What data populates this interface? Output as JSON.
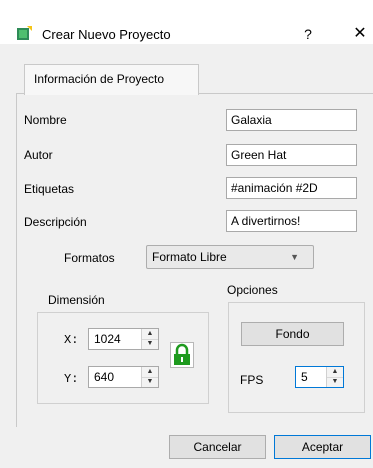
{
  "window": {
    "title": "Crear Nuevo Proyecto",
    "help_label": "?",
    "close_label": "✕"
  },
  "tabs": [
    {
      "label": "Información de Proyecto",
      "active": true
    }
  ],
  "form": {
    "name": {
      "label": "Nombre",
      "value": "Galaxia"
    },
    "author": {
      "label": "Autor",
      "value": "Green Hat"
    },
    "tags": {
      "label": "Etiquetas",
      "value": "#animación #2D"
    },
    "description": {
      "label": "Descripción",
      "value": "A divertirnos!"
    },
    "formats": {
      "label": "Formatos",
      "selected": "Formato Libre"
    }
  },
  "dimension": {
    "title": "Dimensión",
    "x_label": "X:",
    "x_value": "1024",
    "y_label": "Y:",
    "y_value": "640",
    "lock_color": "#1e9a1e"
  },
  "options": {
    "title": "Opciones",
    "background_button": "Fondo",
    "fps_label": "FPS",
    "fps_value": "5"
  },
  "footer": {
    "cancel_label": "Cancelar",
    "accept_label": "Aceptar"
  },
  "colors": {
    "accent": "#0078d7"
  }
}
